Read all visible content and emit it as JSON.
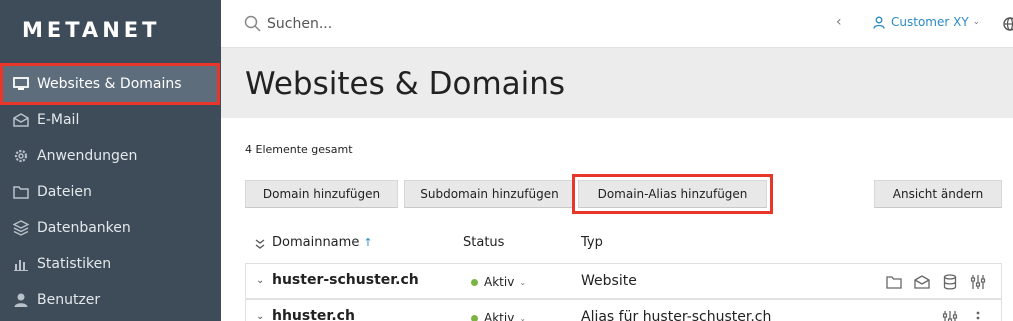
{
  "sidebar": {
    "logo": "METANET",
    "items": [
      {
        "label": "Websites & Domains",
        "icon": "monitor-icon"
      },
      {
        "label": "E-Mail",
        "icon": "envelope-icon"
      },
      {
        "label": "Anwendungen",
        "icon": "gear-icon"
      },
      {
        "label": "Dateien",
        "icon": "folder-icon"
      },
      {
        "label": "Datenbanken",
        "icon": "database-icon"
      },
      {
        "label": "Statistiken",
        "icon": "bar-chart-icon"
      },
      {
        "label": "Benutzer",
        "icon": "user-icon"
      }
    ]
  },
  "header": {
    "search_placeholder": "Suchen...",
    "customer": "Customer XY"
  },
  "main": {
    "title": "Websites & Domains",
    "count": "4 Elemente gesamt",
    "buttons": {
      "add_domain": "Domain hinzufügen",
      "add_subdomain": "Subdomain hinzufügen",
      "add_alias": "Domain-Alias hinzufügen",
      "change_view": "Ansicht ändern"
    },
    "table": {
      "headers": {
        "domain": "Domainname",
        "status": "Status",
        "type": "Typ"
      },
      "rows": [
        {
          "domain": "huster-schuster.ch",
          "status": "Aktiv",
          "type": "Website"
        },
        {
          "domain": "hhuster.ch",
          "status": "Aktiv",
          "type": "Alias für huster-schuster.ch"
        }
      ]
    }
  },
  "colors": {
    "sidebar": "#3e4c59",
    "highlight": "#e8362a",
    "accent": "#2b8ac6",
    "status_active": "#7cb342"
  }
}
